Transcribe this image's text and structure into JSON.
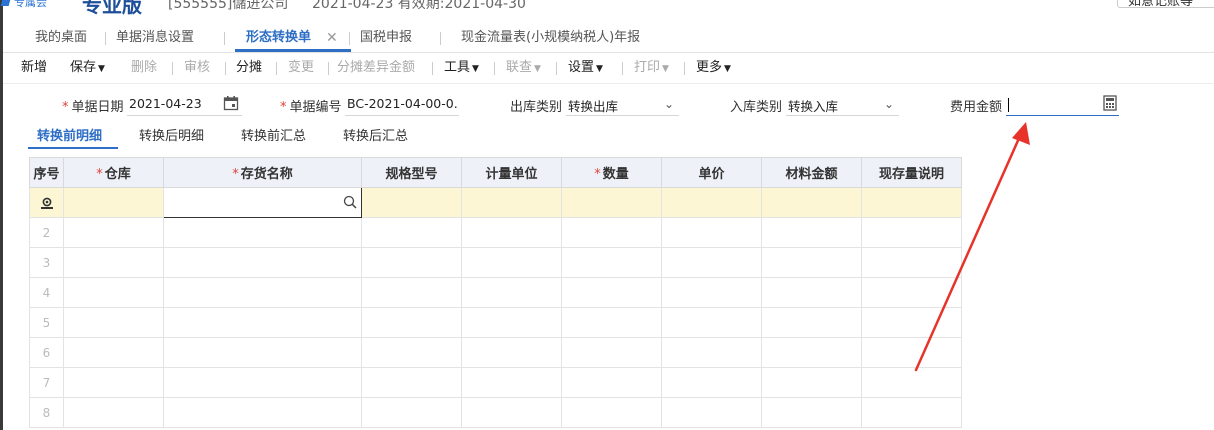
{
  "header": {
    "brand_small": "专属会",
    "brand_big": "专业版",
    "company": "[555555]儲进公司",
    "period": "2021-04-23  有效期:2021-04-30",
    "right_button": "如意记账等"
  },
  "tabs": [
    {
      "label": "我的桌面"
    },
    {
      "label": "单据消息设置"
    },
    {
      "label": "形态转换单",
      "close": "✕"
    },
    {
      "label": "国税申报"
    },
    {
      "label": "现金流量表(小规模纳税人)年报"
    }
  ],
  "toolbar": {
    "new": "新增",
    "save": "保存",
    "delete": "删除",
    "audit": "审核",
    "allocate": "分摊",
    "change": "变更",
    "alloc_diff": "分摊差异金额",
    "tools": "工具",
    "query": "联查",
    "settings": "设置",
    "print": "打印",
    "more": "更多"
  },
  "form": {
    "date_label": "单据日期",
    "date_value": "2021-04-23",
    "code_label": "单据编号",
    "code_value": "BC-2021-04-00-0...",
    "out_type_label": "出库类别",
    "out_type_value": "转换出库",
    "in_type_label": "入库类别",
    "in_type_value": "转换入库",
    "fee_label": "费用金额",
    "fee_value": ""
  },
  "subtabs": [
    {
      "label": "转换前明细"
    },
    {
      "label": "转换后明细"
    },
    {
      "label": "转换前汇总"
    },
    {
      "label": "转换后汇总"
    }
  ],
  "grid": {
    "columns": [
      {
        "label": "序号",
        "required": false
      },
      {
        "label": "仓库",
        "required": true
      },
      {
        "label": "存货名称",
        "required": true
      },
      {
        "label": "规格型号",
        "required": false
      },
      {
        "label": "计量单位",
        "required": false
      },
      {
        "label": "数量",
        "required": true
      },
      {
        "label": "单价",
        "required": false
      },
      {
        "label": "材料金额",
        "required": false
      },
      {
        "label": "现存量说明",
        "required": false
      }
    ],
    "row_numbers": [
      "2",
      "3",
      "4",
      "5",
      "6",
      "7",
      "8"
    ]
  },
  "colors": {
    "accent": "#2e6ec5",
    "required": "#e0423c",
    "active_row": "#fdf6d4",
    "annotation_arrow": "#e8332a"
  }
}
